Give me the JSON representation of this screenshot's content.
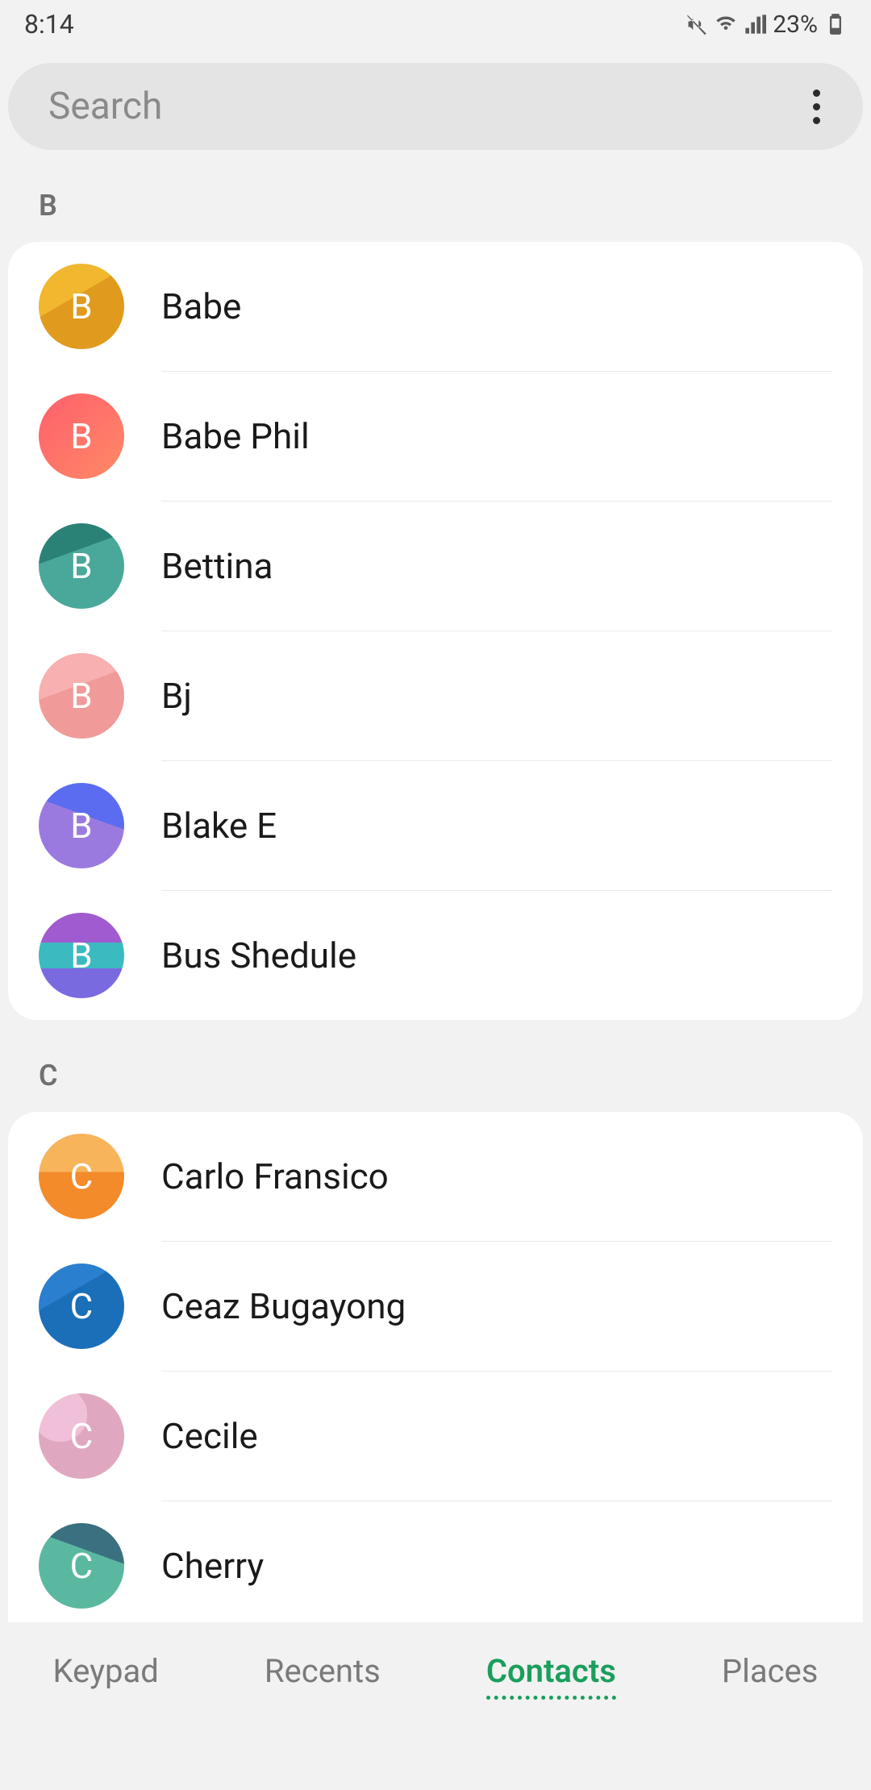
{
  "status": {
    "time": "8:14",
    "battery_pct": "23%"
  },
  "search": {
    "placeholder": "Search"
  },
  "sections": [
    {
      "letter": "B",
      "contacts": [
        {
          "name": "Babe",
          "initial": "B",
          "bg": "linear-gradient(150deg,#f0b72f 0%,#f0b72f 40%,#e09a1e 40%,#e09a1e 100%)"
        },
        {
          "name": "Babe Phil",
          "initial": "B",
          "bg": "linear-gradient(135deg,#ff5f6d 0%,#ff8a65 100%)"
        },
        {
          "name": "Bettina",
          "initial": "B",
          "bg": "linear-gradient(160deg,#2a8277 0%,#2a8277 35%,#4aa89a 35%,#4aa89a 100%)"
        },
        {
          "name": "Bj",
          "initial": "B",
          "bg": "linear-gradient(160deg,#f8b0b0 0%,#f8b0b0 40%,#f09a9a 40%,#f09a9a 100%)"
        },
        {
          "name": "Blake E",
          "initial": "B",
          "bg": "linear-gradient(200deg,#5b6cf0 0%,#5b6cf0 40%,#9b7ae0 40%,#9b7ae0 100%)"
        },
        {
          "name": "Bus Shedule",
          "initial": "B",
          "bg": "linear-gradient(180deg,#a05bd0 0%,#a05bd0 35%,#3bbac0 35%,#3bbac0 65%,#7a6ae0 65%)"
        }
      ]
    },
    {
      "letter": "C",
      "contacts": [
        {
          "name": "Carlo Fransico",
          "initial": "C",
          "bg": "linear-gradient(180deg,#f8b45a 0%,#f8b45a 45%,#f38b2a 45%)"
        },
        {
          "name": "Ceaz Bugayong",
          "initial": "C",
          "bg": "linear-gradient(150deg,#2a7fce 0%,#2a7fce 35%,#1a6fb8 35%,#1a6fb8 100%)"
        },
        {
          "name": "Cecile",
          "initial": "C",
          "bg": "radial-gradient(circle at 25% 25%,#f0c0d8 0%,#f0c0d8 30%,#e0a8c0 30%)"
        },
        {
          "name": "Cherry",
          "initial": "C",
          "bg": "linear-gradient(200deg,#3a7080 0%,#3a7080 35%,#5ab8a0 35%,#5ab8a0 100%)"
        }
      ]
    }
  ],
  "nav": {
    "keypad": "Keypad",
    "recents": "Recents",
    "contacts": "Contacts",
    "places": "Places"
  }
}
